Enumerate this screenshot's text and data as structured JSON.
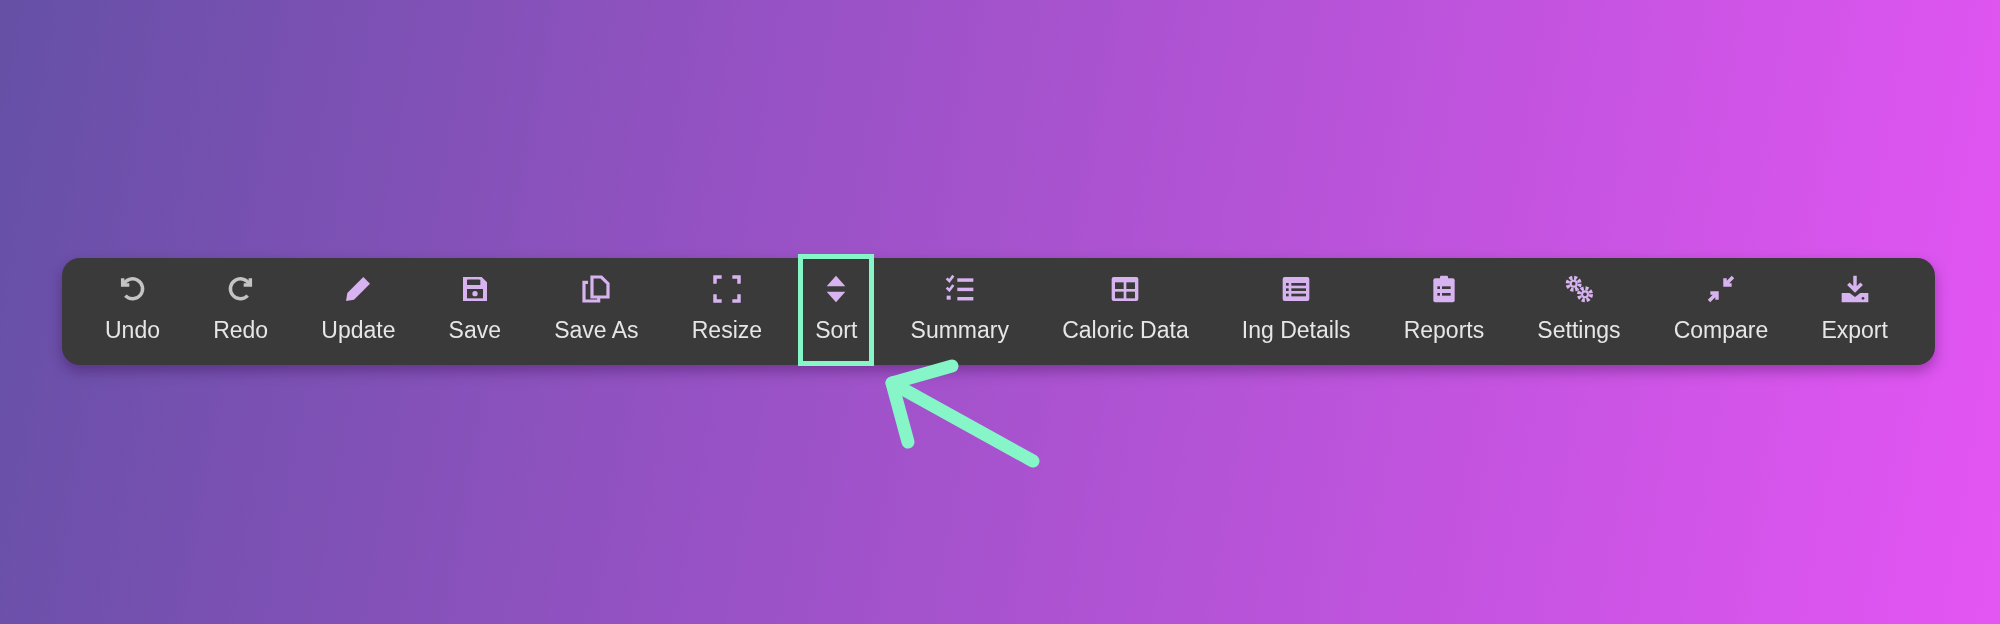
{
  "toolbar": {
    "items": [
      {
        "label": "Undo",
        "disabled": true,
        "highlighted": false
      },
      {
        "label": "Redo",
        "disabled": true,
        "highlighted": false
      },
      {
        "label": "Update",
        "disabled": false,
        "highlighted": false
      },
      {
        "label": "Save",
        "disabled": false,
        "highlighted": false
      },
      {
        "label": "Save As",
        "disabled": false,
        "highlighted": false
      },
      {
        "label": "Resize",
        "disabled": false,
        "highlighted": false
      },
      {
        "label": "Sort",
        "disabled": false,
        "highlighted": true
      },
      {
        "label": "Summary",
        "disabled": false,
        "highlighted": false
      },
      {
        "label": "Caloric Data",
        "disabled": false,
        "highlighted": false
      },
      {
        "label": "Ing Details",
        "disabled": false,
        "highlighted": false
      },
      {
        "label": "Reports",
        "disabled": false,
        "highlighted": false
      },
      {
        "label": "Settings",
        "disabled": false,
        "highlighted": false
      },
      {
        "label": "Compare",
        "disabled": false,
        "highlighted": false
      },
      {
        "label": "Export",
        "disabled": false,
        "highlighted": false
      }
    ]
  }
}
